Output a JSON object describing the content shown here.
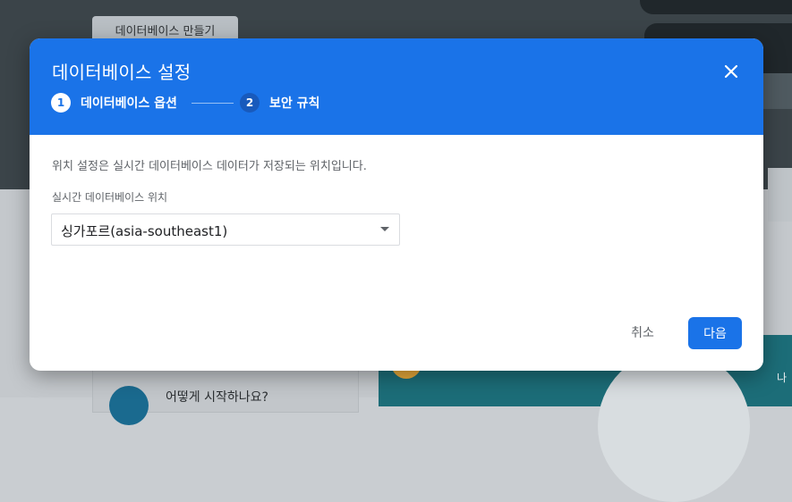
{
  "background": {
    "create_db_button": "데이터베이스 만들기",
    "left_card_text": "어떻게 시작하나요?",
    "right_partial_text": "나"
  },
  "dialog": {
    "title": "데이터베이스 설정",
    "close_icon": "close-icon",
    "steps": [
      {
        "number": "1",
        "label": "데이터베이스 옵션",
        "state": "active"
      },
      {
        "number": "2",
        "label": "보안 규칙",
        "state": "inactive"
      }
    ],
    "description": "위치 설정은 실시간 데이터베이스 데이터가 저장되는 위치입니다.",
    "location_field": {
      "label": "실시간 데이터베이스 위치",
      "value": "싱가포르(asia-southeast1)"
    },
    "actions": {
      "cancel_label": "취소",
      "next_label": "다음"
    }
  },
  "colors": {
    "primary": "#1a73e8",
    "header_text": "#ffffff",
    "muted_text": "#5f6368"
  }
}
